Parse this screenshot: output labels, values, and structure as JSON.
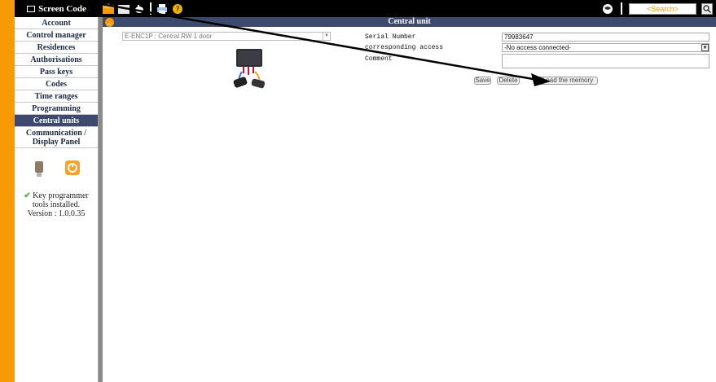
{
  "app": {
    "title": "Screen Code"
  },
  "toolbar": {
    "icons": [
      "home-icon",
      "blank-icon",
      "hand-icon",
      "printer-icon",
      "help-icon"
    ],
    "right_icons": [
      "globe-icon"
    ],
    "search_placeholder": "<Search>"
  },
  "sidebar": {
    "items": [
      {
        "label": "Account"
      },
      {
        "label": "Control manager"
      },
      {
        "label": "Residences"
      },
      {
        "label": "Authorisations"
      },
      {
        "label": "Pass keys"
      },
      {
        "label": "Codes"
      },
      {
        "label": "Time ranges"
      },
      {
        "label": "Programming"
      },
      {
        "label": "Central units",
        "active": true
      },
      {
        "label": "Communication / Display Panel"
      }
    ],
    "tool_icons": [
      "usb-programmer-icon",
      "power-icon"
    ],
    "key_status": "Key programmer tools installed.",
    "version": "Version : 1.0.0.35"
  },
  "panel": {
    "title": "Central unit",
    "device_select": "E-ENC1P : Central RW 1 door",
    "fields": {
      "serial_label": "Serial Number",
      "serial_value": "79983647",
      "access_label": "corresponding access",
      "access_value": "-No access connected-",
      "comment_label": "Comment",
      "comment_value": ""
    },
    "buttons": {
      "save": "Save",
      "delete": "Delete",
      "load": "Load the memory"
    }
  },
  "colors": {
    "accent": "#f79a06",
    "header": "#3d4a6e",
    "topbar": "#000000"
  }
}
